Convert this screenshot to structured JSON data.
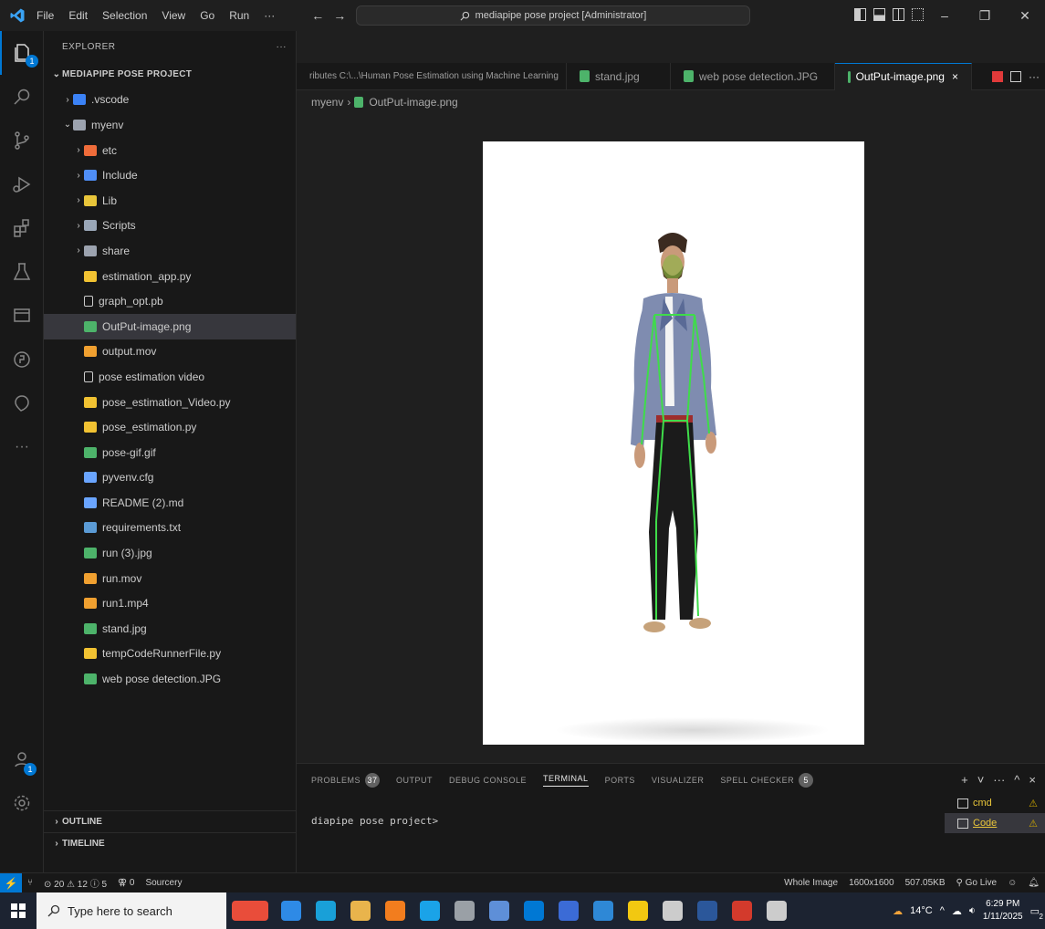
{
  "titlebar": {
    "menu": [
      "File",
      "Edit",
      "Selection",
      "View",
      "Go",
      "Run",
      "···"
    ],
    "command_center": "mediapipe pose project [Administrator]"
  },
  "explorer": {
    "header": "EXPLORER",
    "more": "···",
    "root": "MEDIAPIPE POSE PROJECT",
    "items": [
      {
        "label": ".vscode",
        "indent": 1,
        "kind": "folder",
        "chev": "›",
        "color": "#3b82f6"
      },
      {
        "label": "myenv",
        "indent": 1,
        "kind": "folder-open",
        "chev": "⌄",
        "color": "#9ca3af"
      },
      {
        "label": "etc",
        "indent": 2,
        "kind": "folder",
        "chev": "›",
        "color": "#ef6c3a"
      },
      {
        "label": "Include",
        "indent": 2,
        "kind": "folder",
        "chev": "›",
        "color": "#4f8ef7"
      },
      {
        "label": "Lib",
        "indent": 2,
        "kind": "folder",
        "chev": "›",
        "color": "#e8c53a"
      },
      {
        "label": "Scripts",
        "indent": 2,
        "kind": "folder",
        "chev": "›",
        "color": "#9aa7b8"
      },
      {
        "label": "share",
        "indent": 2,
        "kind": "folder",
        "chev": "›",
        "color": "#9ca3af"
      },
      {
        "label": "estimation_app.py",
        "indent": 2,
        "kind": "py",
        "chev": "",
        "color": "#f1c232"
      },
      {
        "label": "graph_opt.pb",
        "indent": 2,
        "kind": "file",
        "chev": "",
        "color": "#cccccc"
      },
      {
        "label": "OutPut-image.png",
        "indent": 2,
        "kind": "img",
        "chev": "",
        "color": "#4db36a",
        "selected": true
      },
      {
        "label": "output.mov",
        "indent": 2,
        "kind": "video",
        "chev": "",
        "color": "#f0a030"
      },
      {
        "label": "pose estimation video",
        "indent": 2,
        "kind": "file",
        "chev": "",
        "color": "#cccccc"
      },
      {
        "label": "pose_estimation_Video.py",
        "indent": 2,
        "kind": "py",
        "chev": "",
        "color": "#f1c232"
      },
      {
        "label": "pose_estimation.py",
        "indent": 2,
        "kind": "py",
        "chev": "",
        "color": "#f1c232"
      },
      {
        "label": "pose-gif.gif",
        "indent": 2,
        "kind": "img",
        "chev": "",
        "color": "#4db36a"
      },
      {
        "label": "pyvenv.cfg",
        "indent": 2,
        "kind": "cfg",
        "chev": "",
        "color": "#6aa5ff"
      },
      {
        "label": "README (2).md",
        "indent": 2,
        "kind": "md",
        "chev": "",
        "color": "#6aa5ff"
      },
      {
        "label": "requirements.txt",
        "indent": 2,
        "kind": "txt",
        "chev": "",
        "color": "#5b9bd5"
      },
      {
        "label": "run (3).jpg",
        "indent": 2,
        "kind": "img",
        "chev": "",
        "color": "#4db36a"
      },
      {
        "label": "run.mov",
        "indent": 2,
        "kind": "video",
        "chev": "",
        "color": "#f0a030"
      },
      {
        "label": "run1.mp4",
        "indent": 2,
        "kind": "video",
        "chev": "",
        "color": "#f0a030"
      },
      {
        "label": "stand.jpg",
        "indent": 2,
        "kind": "img",
        "chev": "",
        "color": "#4db36a"
      },
      {
        "label": "tempCodeRunnerFile.py",
        "indent": 2,
        "kind": "py",
        "chev": "",
        "color": "#f1c232"
      },
      {
        "label": "web pose detection.JPG",
        "indent": 2,
        "kind": "img",
        "chev": "",
        "color": "#4db36a"
      }
    ],
    "outline": "OUTLINE",
    "timeline": "TIMELINE"
  },
  "tabs": [
    {
      "label": "ributes C:\\...\\Human Pose Estimation using Machine Learning",
      "active": false,
      "icon": false
    },
    {
      "label": "stand.jpg",
      "active": false,
      "icon": true
    },
    {
      "label": "web pose detection.JPG",
      "active": false,
      "icon": true
    },
    {
      "label": "OutPut-image.png",
      "active": true,
      "icon": true,
      "close": "×"
    }
  ],
  "breadcrumb": {
    "folder": "myenv",
    "sep": "›",
    "file": "OutPut-image.png"
  },
  "panel": {
    "tabs": [
      {
        "label": "PROBLEMS",
        "badge": "37"
      },
      {
        "label": "OUTPUT",
        "badge": ""
      },
      {
        "label": "DEBUG CONSOLE",
        "badge": ""
      },
      {
        "label": "TERMINAL",
        "badge": "",
        "active": true
      },
      {
        "label": "PORTS",
        "badge": ""
      },
      {
        "label": "VISUALIZER",
        "badge": ""
      },
      {
        "label": "SPELL CHECKER",
        "badge": "5"
      }
    ],
    "terminal_line": "diapipe pose project>",
    "terminals": [
      {
        "label": "cmd",
        "warn": "⚠",
        "active": false
      },
      {
        "label": "Code",
        "warn": "⚠",
        "active": true
      }
    ],
    "actions": [
      "+",
      "˅",
      "···",
      "^",
      "×"
    ]
  },
  "statusbar": {
    "left": [
      "⊙ 20 ⚠ 12 ⓘ 5",
      "⚢ 0",
      "Sourcery"
    ],
    "right": [
      "Whole Image",
      "1600x1600",
      "507.05KB",
      "Go Live"
    ]
  },
  "taskbar": {
    "search_placeholder": "Type here to search",
    "weather": "14°C",
    "time": "6:29 PM",
    "date": "1/11/2025",
    "notif": "2",
    "apps": [
      "#e94d3a",
      "#2e8ae6",
      "#19a0d8",
      "#e9b44c",
      "#f27d1e",
      "#1aa3e8",
      "#9aa0a6",
      "#5e8fd8",
      "#0078d4",
      "#3b6bd6",
      "#2e88d6",
      "#f2c811",
      "#cccccc",
      "#2b579a",
      "#d33a2c",
      "#cccccc"
    ]
  },
  "image": {
    "alt": "OutPut-image.png"
  }
}
